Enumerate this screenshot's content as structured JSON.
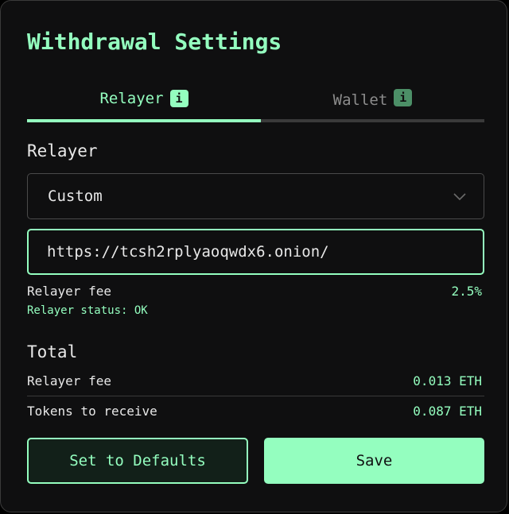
{
  "modal": {
    "title": "Withdrawal Settings"
  },
  "tabs": [
    {
      "label": "Relayer",
      "info_icon": "i",
      "active": true
    },
    {
      "label": "Wallet",
      "info_icon": "i",
      "active": false
    }
  ],
  "relayer": {
    "section_label": "Relayer",
    "select": {
      "value": "Custom",
      "icon": "chevron-down-icon"
    },
    "url_input": {
      "value": "https://tcsh2rplyaoqwdx6.onion/"
    },
    "fee_label": "Relayer fee",
    "fee_value": "2.5%",
    "status_text": "Relayer status: OK"
  },
  "total": {
    "section_label": "Total",
    "rows": [
      {
        "label": "Relayer fee",
        "value": "0.013 ETH"
      },
      {
        "label": "Tokens to receive",
        "value": "0.087 ETH"
      }
    ]
  },
  "buttons": {
    "defaults_label": "Set to Defaults",
    "save_label": "Save"
  },
  "colors": {
    "accent": "#94febf",
    "background": "#0f0f10",
    "text": "#e8e8e8",
    "muted": "#8c8c8c"
  }
}
